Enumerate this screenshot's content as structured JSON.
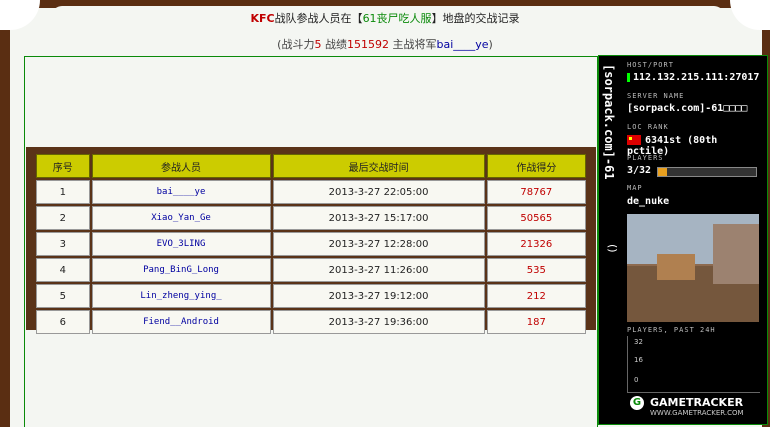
{
  "header": {
    "kfc": "KFC",
    "title_part1": "战队参战人员在【",
    "clan_name": "61丧尸吃人服",
    "title_part2": "】地盘的交战记录"
  },
  "subtitle": {
    "prefix": "(战斗力",
    "power": "5",
    "mid1": " 战绩",
    "record": "151592",
    "mid2": " 主战将军",
    "general": "bai____ye",
    "suffix": ")"
  },
  "table": {
    "headers": [
      "序号",
      "参战人员",
      "最后交战时间",
      "作战得分"
    ],
    "rows": [
      [
        "1",
        "bai____ye",
        "2013-3-27 22:05:00",
        "78767"
      ],
      [
        "2",
        "Xiao_Yan_Ge",
        "2013-3-27 15:17:00",
        "50565"
      ],
      [
        "3",
        "EVO_3LING",
        "2013-3-27 12:28:00",
        "21326"
      ],
      [
        "4",
        "Pang_BinG_Long",
        "2013-3-27 11:26:00",
        "535"
      ],
      [
        "5",
        "Lin_zheng_ying_",
        "2013-3-27 19:12:00",
        "212"
      ],
      [
        "6",
        "Fiend__Android",
        "2013-3-27 19:36:00",
        "187"
      ]
    ]
  },
  "gametracker": {
    "vertical_title": "[sorpack.com]-61",
    "paren": "()",
    "host_label": "HOST/PORT",
    "host_value": "112.132.215.111:27017",
    "server_label": "SERVER NAME",
    "server_value": "[sorpack.com]-61□□□□",
    "loc_label": "LOC  RANK",
    "rank_value": "6341st (80th pctile)",
    "players_label": "PLAYERS",
    "players_value": "3/32",
    "players_fraction": 0.09,
    "map_label": "MAP",
    "map_value": "de_nuke",
    "past_label": "PLAYERS, PAST 24H",
    "tick_32": "32",
    "tick_16": "16",
    "tick_0": "0",
    "brand": "GAMETRACKER",
    "brand_url": "WWW.GAMETRACKER.COM"
  }
}
